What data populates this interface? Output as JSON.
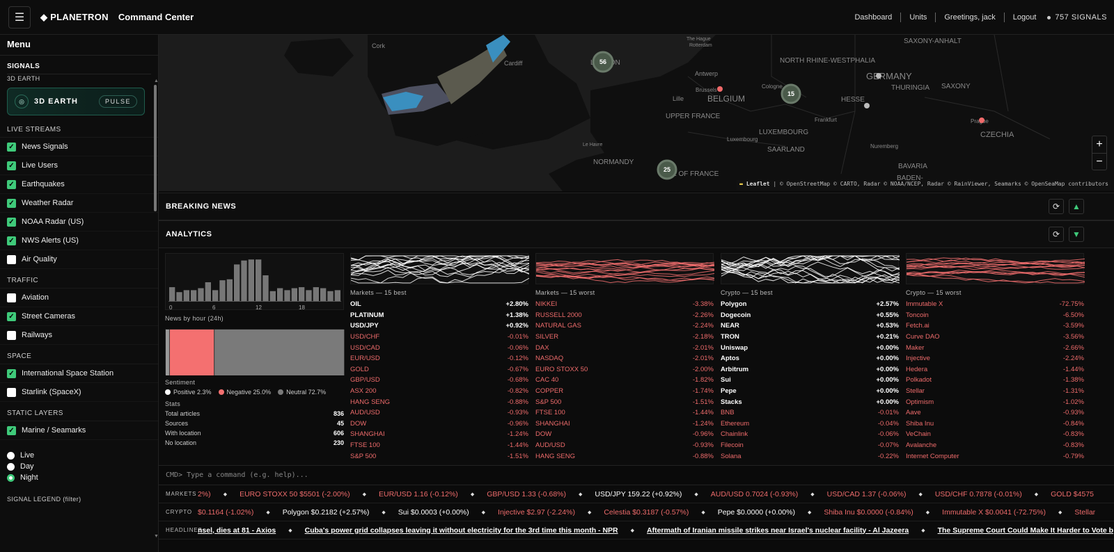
{
  "header": {
    "menu_icon": "hamburger-icon",
    "brand": "PLANETRON",
    "subtitle": "Command Center",
    "nav": [
      "Dashboard",
      "Units",
      "Greetings, jack",
      "Logout"
    ],
    "signals": "757 SIGNALS"
  },
  "sidebar": {
    "title": "Menu",
    "signals_heading": "SIGNALS",
    "earth_heading": "3D EARTH",
    "earth_label": "3D EARTH",
    "pulse_label": "PULSE",
    "groups": [
      {
        "heading": "LIVE STREAMS",
        "items": [
          {
            "label": "News Signals",
            "checked": true
          },
          {
            "label": "Live Users",
            "checked": true
          },
          {
            "label": "Earthquakes",
            "checked": true
          },
          {
            "label": "Weather Radar",
            "checked": true
          },
          {
            "label": "NOAA Radar (US)",
            "checked": true
          },
          {
            "label": "NWS Alerts (US)",
            "checked": true
          },
          {
            "label": "Air Quality",
            "checked": false
          }
        ]
      },
      {
        "heading": "TRAFFIC",
        "items": [
          {
            "label": "Aviation",
            "checked": false
          },
          {
            "label": "Street Cameras",
            "checked": true
          },
          {
            "label": "Railways",
            "checked": false
          }
        ]
      },
      {
        "heading": "SPACE",
        "items": [
          {
            "label": "International Space Station",
            "checked": true
          },
          {
            "label": "Starlink (SpaceX)",
            "checked": false
          }
        ]
      },
      {
        "heading": "STATIC LAYERS",
        "items": [
          {
            "label": "Marine / Seamarks",
            "checked": true
          }
        ]
      }
    ],
    "time_modes": [
      {
        "label": "Live",
        "selected": false
      },
      {
        "label": "Day",
        "selected": false
      },
      {
        "label": "Night",
        "selected": true
      }
    ],
    "legend_heading": "SIGNAL LEGEND (filter)"
  },
  "map": {
    "labels": [
      "Cork",
      "Cardiff",
      "LONDON",
      "The Hague",
      "Rotterdam",
      "Antwerp",
      "Brussels",
      "BELGIUM",
      "Lille",
      "UPPER FRANCE",
      "Le Havre",
      "NORMANDY",
      "ISLE OF FRANCE",
      "LUXEMBOURG",
      "Luxembourg",
      "SAARLAND",
      "Cologne",
      "NORTH RHINE-WESTPHALIA",
      "HESSE",
      "Frankfurt",
      "GERMANY",
      "THURINGIA",
      "SAXONY-ANHALT",
      "SAXONY",
      "Prague",
      "CZECHIA",
      "Nuremberg",
      "BAVARIA",
      "BADEN-"
    ],
    "clusters": [
      "56",
      "15",
      "25"
    ],
    "zoom_in": "+",
    "zoom_out": "−",
    "attribution_leaflet": "Leaflet",
    "attribution_rest": "| © OpenStreetMap © CARTO, Radar © NOAA/NCEP, Radar © RainViewer, Seamarks © OpenSeaMap contributors"
  },
  "breaking_news": {
    "title": "BREAKING NEWS",
    "refresh_icon": "refresh-icon",
    "toggle_icon": "triangle-up-icon"
  },
  "analytics": {
    "title": "ANALYTICS",
    "refresh_icon": "refresh-icon",
    "toggle_icon": "triangle-down-icon",
    "news_by_hour_label": "News by hour (24h)",
    "hour_ticks": [
      "0",
      "6",
      "12",
      "18"
    ],
    "sentiment_label": "Sentiment",
    "sentiment": [
      {
        "label": "Positive 2.3%",
        "value": 2.3,
        "color": "#ffffff"
      },
      {
        "label": "Negative 25.0%",
        "value": 25.0,
        "color": "#f47070"
      },
      {
        "label": "Neutral 72.7%",
        "value": 72.7,
        "color": "#7a7a7a"
      }
    ],
    "stats_label": "Stats",
    "stats": [
      {
        "label": "Total articles",
        "value": "836"
      },
      {
        "label": "Sources",
        "value": "45"
      },
      {
        "label": "With location",
        "value": "606"
      },
      {
        "label": "No location",
        "value": "230"
      }
    ],
    "columns": [
      {
        "title": "Markets — 15 best",
        "spark_color": "#ffffff",
        "rows": [
          [
            "OIL",
            "+2.80%"
          ],
          [
            "PLATINUM",
            "+1.38%"
          ],
          [
            "USD/JPY",
            "+0.92%"
          ],
          [
            "USD/CHF",
            "-0.01%"
          ],
          [
            "USD/CAD",
            "-0.06%"
          ],
          [
            "EUR/USD",
            "-0.12%"
          ],
          [
            "GOLD",
            "-0.67%"
          ],
          [
            "GBP/USD",
            "-0.68%"
          ],
          [
            "ASX 200",
            "-0.82%"
          ],
          [
            "HANG SENG",
            "-0.88%"
          ],
          [
            "AUD/USD",
            "-0.93%"
          ],
          [
            "DOW",
            "-0.96%"
          ],
          [
            "SHANGHAI",
            "-1.24%"
          ],
          [
            "FTSE 100",
            "-1.44%"
          ],
          [
            "S&P 500",
            "-1.51%"
          ]
        ]
      },
      {
        "title": "Markets — 15 worst",
        "spark_color": "#f47070",
        "rows": [
          [
            "NIKKEI",
            "-3.38%"
          ],
          [
            "RUSSELL 2000",
            "-2.26%"
          ],
          [
            "NATURAL GAS",
            "-2.24%"
          ],
          [
            "SILVER",
            "-2.18%"
          ],
          [
            "DAX",
            "-2.01%"
          ],
          [
            "NASDAQ",
            "-2.01%"
          ],
          [
            "EURO STOXX 50",
            "-2.00%"
          ],
          [
            "CAC 40",
            "-1.82%"
          ],
          [
            "COPPER",
            "-1.74%"
          ],
          [
            "S&P 500",
            "-1.51%"
          ],
          [
            "FTSE 100",
            "-1.44%"
          ],
          [
            "SHANGHAI",
            "-1.24%"
          ],
          [
            "DOW",
            "-0.96%"
          ],
          [
            "AUD/USD",
            "-0.93%"
          ],
          [
            "HANG SENG",
            "-0.88%"
          ]
        ]
      },
      {
        "title": "Crypto — 15 best",
        "spark_color": "#ffffff",
        "rows": [
          [
            "Polygon",
            "+2.57%"
          ],
          [
            "Dogecoin",
            "+0.55%"
          ],
          [
            "NEAR",
            "+0.53%"
          ],
          [
            "TRON",
            "+0.21%"
          ],
          [
            "Uniswap",
            "+0.00%"
          ],
          [
            "Aptos",
            "+0.00%"
          ],
          [
            "Arbitrum",
            "+0.00%"
          ],
          [
            "Sui",
            "+0.00%"
          ],
          [
            "Pepe",
            "+0.00%"
          ],
          [
            "Stacks",
            "+0.00%"
          ],
          [
            "BNB",
            "-0.01%"
          ],
          [
            "Ethereum",
            "-0.04%"
          ],
          [
            "Chainlink",
            "-0.06%"
          ],
          [
            "Filecoin",
            "-0.07%"
          ],
          [
            "Solana",
            "-0.22%"
          ]
        ]
      },
      {
        "title": "Crypto — 15 worst",
        "spark_color": "#f47070",
        "rows": [
          [
            "Immutable X",
            "-72.75%"
          ],
          [
            "Toncoin",
            "-6.50%"
          ],
          [
            "Fetch.ai",
            "-3.59%"
          ],
          [
            "Curve DAO",
            "-3.56%"
          ],
          [
            "Maker",
            "-2.66%"
          ],
          [
            "Injective",
            "-2.24%"
          ],
          [
            "Hedera",
            "-1.44%"
          ],
          [
            "Polkadot",
            "-1.38%"
          ],
          [
            "Stellar",
            "-1.31%"
          ],
          [
            "Optimism",
            "-1.02%"
          ],
          [
            "Aave",
            "-0.93%"
          ],
          [
            "Shiba Inu",
            "-0.84%"
          ],
          [
            "VeChain",
            "-0.83%"
          ],
          [
            "Avalanche",
            "-0.83%"
          ],
          [
            "Internet Computer",
            "-0.79%"
          ]
        ]
      }
    ]
  },
  "chart_data": {
    "type": "bar",
    "categories": [
      "0",
      "1",
      "2",
      "3",
      "4",
      "5",
      "6",
      "7",
      "8",
      "9",
      "10",
      "11",
      "12",
      "13",
      "14",
      "15",
      "16",
      "17",
      "18",
      "19",
      "20",
      "21",
      "22",
      "23"
    ],
    "values": [
      14,
      9,
      11,
      11,
      13,
      19,
      11,
      21,
      22,
      37,
      41,
      42,
      42,
      26,
      10,
      13,
      11,
      13,
      14,
      11,
      14,
      13,
      10,
      11
    ],
    "title": "News by hour (24h)",
    "xlabel": "",
    "ylabel": "",
    "ylim": [
      0,
      45
    ]
  },
  "command": {
    "placeholder": "CMD> Type a command (e.g. help)..."
  },
  "tickers": [
    {
      "label": "MARKETS",
      "items": [
        {
          "text": "2%)",
          "sign": "neg"
        },
        {
          "text": "EURO STOXX 50 $5501 (-2.00%)",
          "sign": "neg"
        },
        {
          "text": "EUR/USD 1.16 (-0.12%)",
          "sign": "neg"
        },
        {
          "text": "GBP/USD 1.33 (-0.68%)",
          "sign": "neg"
        },
        {
          "text": "USD/JPY 159.22 (+0.92%)",
          "sign": "pos"
        },
        {
          "text": "AUD/USD 0.7024 (-0.93%)",
          "sign": "neg"
        },
        {
          "text": "USD/CAD 1.37 (-0.06%)",
          "sign": "neg"
        },
        {
          "text": "USD/CHF 0.7878 (-0.01%)",
          "sign": "neg"
        },
        {
          "text": "GOLD $4575",
          "sign": "neg"
        }
      ]
    },
    {
      "label": "CRYPTO",
      "items": [
        {
          "text": "$0.1164 (-1.02%)",
          "sign": "neg"
        },
        {
          "text": "Polygon $0.2182 (+2.57%)",
          "sign": "pos"
        },
        {
          "text": "Sui $0.0003 (+0.00%)",
          "sign": "pos"
        },
        {
          "text": "Injective $2.97 (-2.24%)",
          "sign": "neg"
        },
        {
          "text": "Celestia $0.3187 (-0.57%)",
          "sign": "neg"
        },
        {
          "text": "Pepe $0.0000 (+0.00%)",
          "sign": "pos"
        },
        {
          "text": "Shiba Inu $0.0000 (-0.84%)",
          "sign": "neg"
        },
        {
          "text": "Immutable X $0.0041 (-72.75%)",
          "sign": "neg"
        },
        {
          "text": "Stellar",
          "sign": "neg"
        }
      ]
    },
    {
      "label": "HEADLINES",
      "items": [
        {
          "text": "nsel, dies at 81 - Axios",
          "sign": "news"
        },
        {
          "text": "Cuba's power grid collapses leaving it without electricity for the 3rd time this month - NPR",
          "sign": "news"
        },
        {
          "text": "Aftermath of Iranian missile strikes near Israel's nuclear facility - Al Jazeera",
          "sign": "news"
        },
        {
          "text": "The Supreme Court Could Make It Harder to Vote b",
          "sign": "news"
        }
      ]
    }
  ],
  "colors": {
    "accent": "#3fca7a",
    "negative": "#ee6b6b",
    "positive": "#ffffff"
  }
}
